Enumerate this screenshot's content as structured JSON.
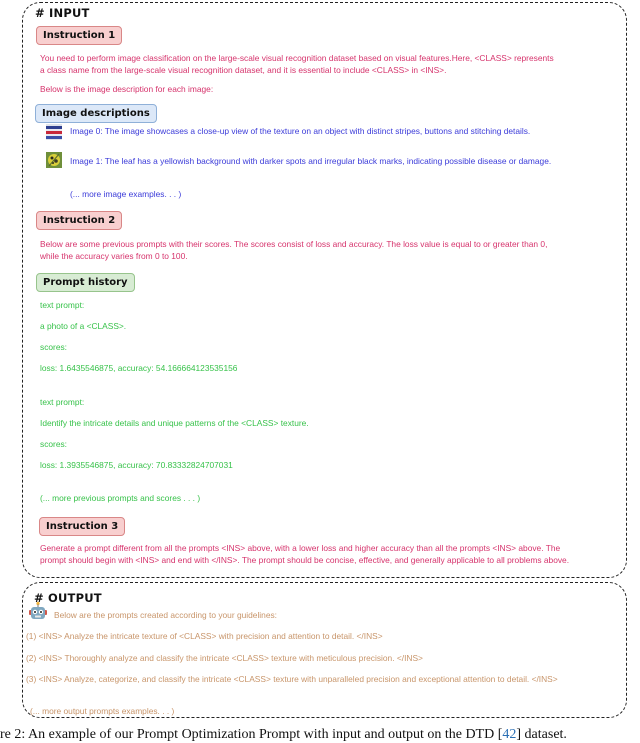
{
  "input": {
    "title": "# INPUT",
    "instruction1": {
      "tag": "Instruction 1",
      "line1": "You need to perform image classification on the large-scale visual recognition dataset based on visual features.Here, <CLASS> represents",
      "line2": "a class name from the large-scale visual recognition dataset, and it is essential to include <CLASS> in <INS>.",
      "line3": "Below is the image description for each image:"
    },
    "image_descriptions": {
      "tag": "Image descriptions",
      "items": [
        {
          "thumb": "fabric-stripes-thumbnail",
          "text": "Image 0: The image showcases a close-up view of the texture on an object with distinct stripes, buttons and stitching details."
        },
        {
          "thumb": "yellow-leaf-thumbnail",
          "text": "Image 1: The leaf has a yellowish background with darker spots and irregular black marks, indicating possible disease or damage."
        }
      ],
      "more": "(... more image examples. . . )"
    },
    "instruction2": {
      "tag": "Instruction 2",
      "line1": "Below are some previous prompts with their scores. The scores consist of loss and accuracy. The loss value is equal to or greater than 0,",
      "line2": "while the accuracy varies from 0 to 100."
    },
    "prompt_history": {
      "tag": "Prompt history",
      "entries": [
        {
          "label": "text prompt:",
          "prompt": "a photo of a <CLASS>.",
          "scores_label": "scores:",
          "scores": "loss: 1.6435546875, accuracy: 54.166664123535156"
        },
        {
          "label": "text prompt:",
          "prompt": "Identify the intricate details and unique patterns of the <CLASS> texture.",
          "scores_label": "scores:",
          "scores": "loss: 1.3935546875, accuracy: 70.83332824707031"
        }
      ],
      "more": "(... more previous prompts and scores . . . )"
    },
    "instruction3": {
      "tag": "Instruction 3",
      "line1": "Generate a prompt different from all the prompts <INS> above, with a lower loss and higher accuracy than all the prompts <INS> above. The",
      "line2": "prompt should begin with <INS> and end with </INS>. The prompt should be concise, effective, and generally applicable to all problems above."
    }
  },
  "output": {
    "title": "# OUTPUT",
    "icon": "robot-icon",
    "intro": "Below are the prompts created according to your guidelines:",
    "prompts": [
      "(1) <INS> Analyze the intricate texture of <CLASS> with precision and attention to detail. </INS>",
      "(2) <INS> Thoroughly analyze and classify the intricate <CLASS> texture with meticulous precision. </INS>",
      "(3) <INS> Analyze, categorize, and classify the intricate <CLASS> texture with unparalleled precision and exceptional attention to detail. </INS>"
    ],
    "more": "(... more output prompts examples. . . )"
  },
  "caption": {
    "prefix": "re 2: An example of our Prompt Optimization Prompt with input and output on the DTD [",
    "ref": "42",
    "suffix": "] dataset."
  }
}
